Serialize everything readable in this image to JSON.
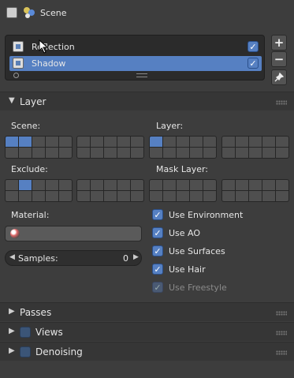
{
  "header": {
    "title": "Scene"
  },
  "layers_list": {
    "items": [
      {
        "label": "Reflection",
        "checked": true,
        "selected": false
      },
      {
        "label": "Shadow",
        "checked": true,
        "selected": true
      }
    ],
    "add_label": "+",
    "remove_label": "−"
  },
  "layer_panel": {
    "title": "Layer",
    "scene_label": "Scene:",
    "layer_label": "Layer:",
    "exclude_label": "Exclude:",
    "mask_layer_label": "Mask Layer:",
    "material_label": "Material:",
    "samples_label": "Samples:",
    "samples_value": "0",
    "options": [
      {
        "label": "Use Environment",
        "checked": true,
        "enabled": true
      },
      {
        "label": "Use AO",
        "checked": true,
        "enabled": true
      },
      {
        "label": "Use Surfaces",
        "checked": true,
        "enabled": true
      },
      {
        "label": "Use Hair",
        "checked": true,
        "enabled": true
      },
      {
        "label": "Use Freestyle",
        "checked": true,
        "enabled": false
      }
    ]
  },
  "panels": [
    {
      "title": "Passes"
    },
    {
      "title": "Views"
    },
    {
      "title": "Denoising"
    }
  ],
  "colors": {
    "accent": "#5680c2",
    "background": "#3d3d3d",
    "list_bg": "#2b2b2b",
    "selected_row": "#5680c2"
  }
}
